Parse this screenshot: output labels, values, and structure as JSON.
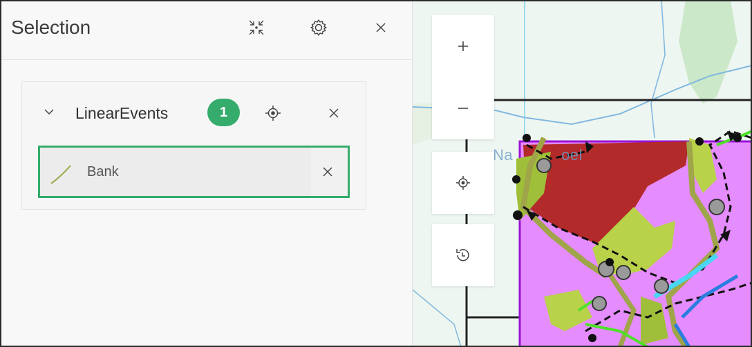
{
  "panel": {
    "title": "Selection",
    "header_icons": [
      "collapse-icon",
      "gear-icon",
      "close-icon"
    ]
  },
  "layer": {
    "name": "LinearEvents",
    "count": "1",
    "features": [
      {
        "label": "Bank",
        "icon": "line-feature-icon"
      }
    ]
  },
  "map": {
    "label_fragment_1": "Na",
    "label_fragment_2": "oel",
    "controls": [
      "zoom-in-icon",
      "zoom-out-icon",
      "locate-icon",
      "history-icon"
    ]
  },
  "colors": {
    "accent_green": "#35ac6b",
    "feature_purple": "#e58cff",
    "feature_red": "#b22a2a",
    "feature_olive": "#9fa548"
  }
}
